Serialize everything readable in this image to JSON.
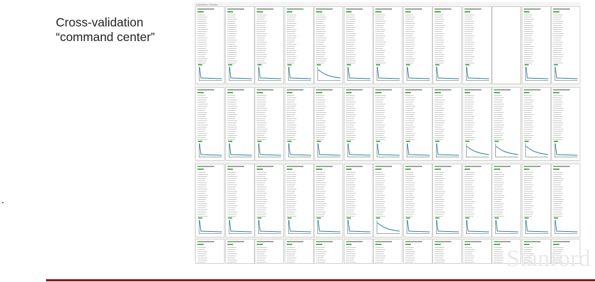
{
  "slide": {
    "title_line1": "Cross-validation",
    "title_line2": "“command center”",
    "logo_text": "Stanford"
  },
  "grid": {
    "caption": "Validation Monitor",
    "rows": 4,
    "cols": 13,
    "blank_cell": [
      0,
      10
    ],
    "curve_cells": [
      [
        0,
        4
      ],
      [
        1,
        9
      ],
      [
        1,
        10
      ],
      [
        1,
        11
      ],
      [
        2,
        6
      ]
    ]
  },
  "colors": {
    "accent": "#8c1515",
    "tag": "#55b25a",
    "curve": "#2e7f96"
  }
}
